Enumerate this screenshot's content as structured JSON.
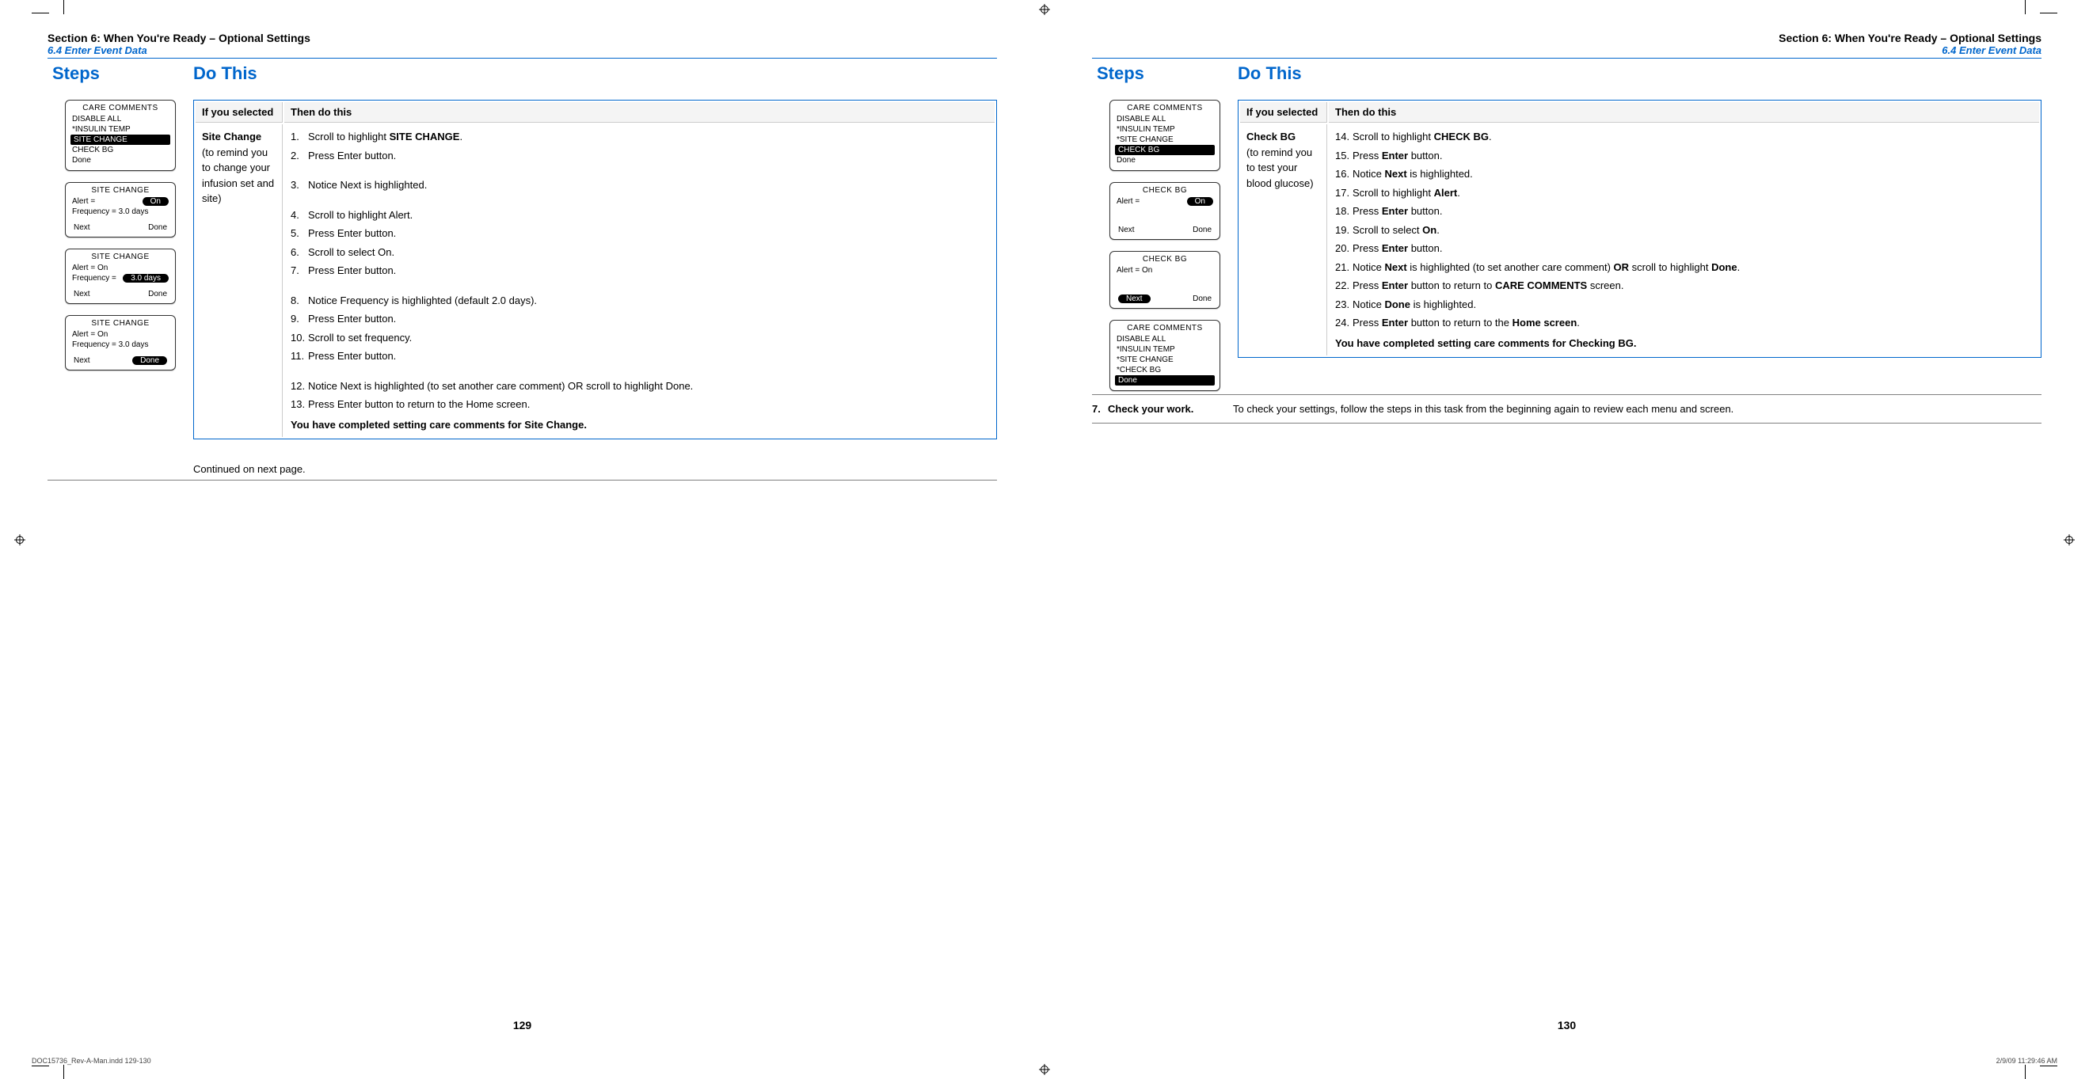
{
  "header": {
    "section": "Section 6: When You're Ready – Optional Settings",
    "subsection": "6.4 Enter Event Data",
    "steps_heading": "Steps",
    "do_heading": "Do This"
  },
  "left": {
    "page_num": "129",
    "continued": "Continued on next page.",
    "table": {
      "th1": "If you selected",
      "th2": "Then do this",
      "sel_title": "Site Change",
      "sel_desc": "(to remind you to change your infusion set and site)",
      "items": [
        {
          "n": "1.",
          "t": "Scroll to highlight ",
          "b": "SITE CHANGE",
          "after": "."
        },
        {
          "n": "2.",
          "t": "Press Enter button."
        },
        {
          "gap": true
        },
        {
          "n": "3.",
          "t": "Notice Next is highlighted."
        },
        {
          "gap": true
        },
        {
          "n": "4.",
          "t": "Scroll to highlight Alert."
        },
        {
          "n": "5.",
          "t": "Press Enter button."
        },
        {
          "n": "6.",
          "t": "Scroll to select On."
        },
        {
          "n": "7.",
          "t": "Press Enter button."
        },
        {
          "gap": true
        },
        {
          "n": "8.",
          "t": "Notice Frequency is highlighted (default 2.0 days)."
        },
        {
          "n": "9.",
          "t": "Press Enter button."
        },
        {
          "n": "10.",
          "t": "Scroll to set frequency."
        },
        {
          "n": "11.",
          "t": "Press Enter button."
        },
        {
          "gap": true
        },
        {
          "n": "12.",
          "t": "Notice Next is highlighted (to set another care comment) OR scroll to highlight Done."
        },
        {
          "n": "13.",
          "t": "Press Enter button to return to the Home screen."
        }
      ],
      "completion": "You have completed setting care comments for Site Change."
    },
    "screens": {
      "care_title": "CARE COMMENTS",
      "care_items": [
        "DISABLE ALL",
        "*INSULIN TEMP",
        "SITE CHANGE",
        "CHECK BG",
        "Done"
      ],
      "sc_title": "SITE CHANGE",
      "alert_eq": "Alert =",
      "on": "On",
      "freq_eq": "Frequency =",
      "freq_val30": "3.0 days",
      "freq_line": "Frequency = 3.0 days",
      "alert_on": "Alert = On",
      "next": "Next",
      "done": "Done"
    }
  },
  "right": {
    "page_num": "130",
    "table": {
      "th1": "If you selected",
      "th2": "Then do this",
      "sel_title": "Check BG",
      "sel_desc": "(to remind you to test your blood glucose)",
      "completion": "You have completed setting care comments for Checking BG."
    },
    "screens": {
      "care_title": "CARE COMMENTS",
      "care_items_top": [
        "DISABLE ALL",
        "*INSULIN TEMP",
        "*SITE CHANGE",
        "CHECK BG",
        "Done"
      ],
      "cb_title": "CHECK BG",
      "alert_eq": "Alert =",
      "on": "On",
      "alert_on": "Alert = On",
      "next": "Next",
      "done": "Done",
      "care_items_bot": [
        "DISABLE ALL",
        "*INSULIN TEMP",
        "*SITE CHANGE",
        "*CHECK BG",
        "Done"
      ]
    },
    "step7": {
      "num": "7.",
      "label": "Check your work.",
      "body": "To check your settings, follow the steps in this task from the beginning again to review each menu and screen."
    }
  },
  "slug": {
    "file": "DOC15736_Rev-A-Man.indd   129-130",
    "stamp": "2/9/09   11:29:46 AM"
  }
}
